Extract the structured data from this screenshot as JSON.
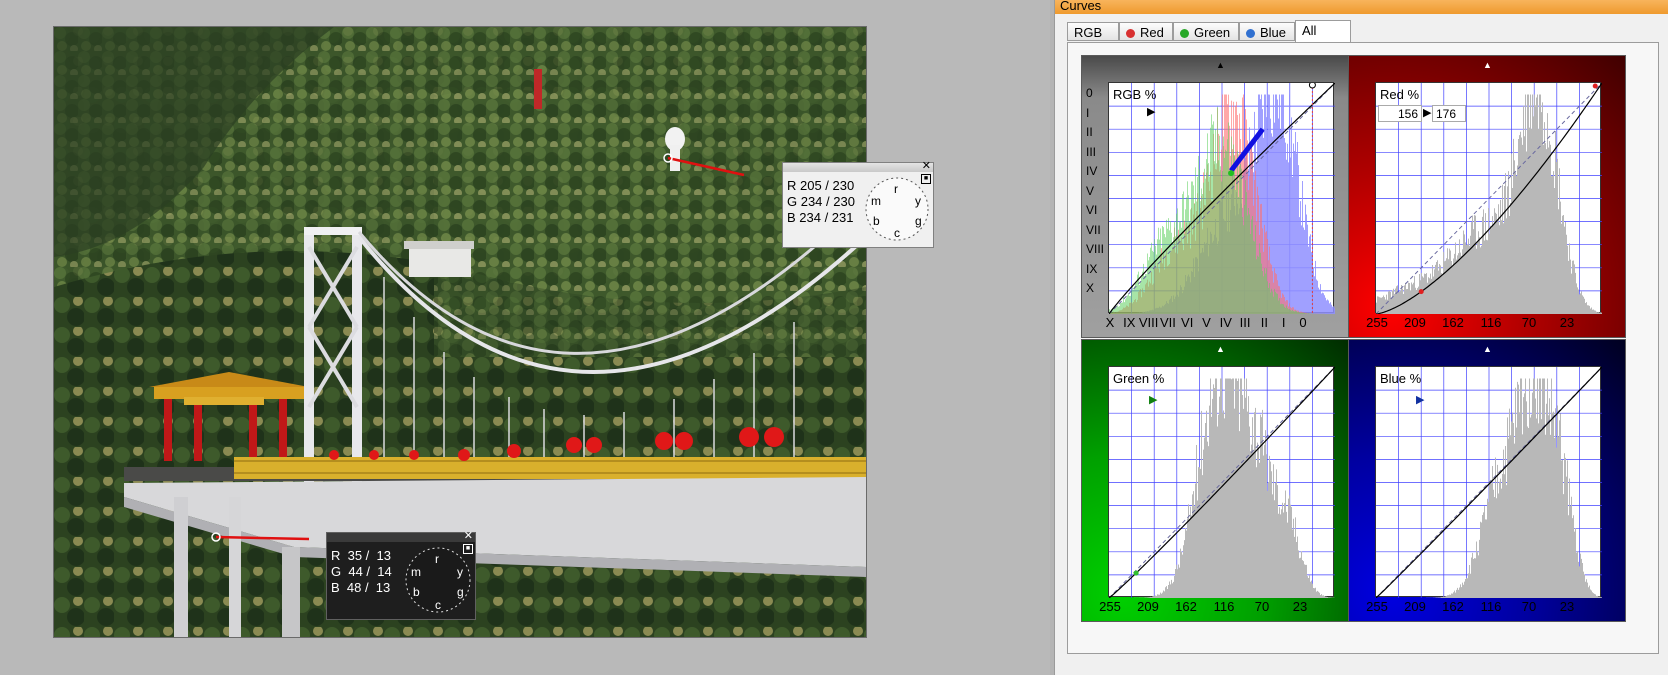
{
  "panel": {
    "title": "Curves",
    "tabs": [
      {
        "label": "RGB",
        "dot": null,
        "active": false
      },
      {
        "label": "Red",
        "dot": "#d83030",
        "active": false
      },
      {
        "label": "Green",
        "dot": "#28a828",
        "active": false
      },
      {
        "label": "Blue",
        "dot": "#3070d0",
        "active": false
      },
      {
        "label": "All",
        "dot": null,
        "active": true
      }
    ]
  },
  "probes": [
    {
      "style": "light",
      "close": "✕",
      "rows": [
        "R 205 / 230",
        "G 234 / 230",
        "B 234 / 231"
      ],
      "wheel": [
        "r",
        "y",
        "g",
        "c",
        "b",
        "m"
      ]
    },
    {
      "style": "dark",
      "close": "✕",
      "rows": [
        "R  35 /  13",
        "G  44 /  14",
        "B  48 /  13"
      ],
      "wheel": [
        "r",
        "y",
        "g",
        "c",
        "b",
        "m"
      ]
    }
  ],
  "graphs": {
    "rgb": {
      "label": "RGB %",
      "yticks": [
        "0",
        "I",
        "II",
        "III",
        "IV",
        "V",
        "VI",
        "VII",
        "VIII",
        "IX",
        "X"
      ],
      "xticks": [
        "X",
        "IX",
        "VIII",
        "VII",
        "VI",
        "V",
        "IV",
        "III",
        "II",
        "I",
        "0"
      ]
    },
    "red": {
      "label": "Red %",
      "input_value": "156",
      "output_value": "176",
      "xticks": [
        "255",
        "209",
        "162",
        "116",
        "70",
        "23"
      ]
    },
    "green": {
      "label": "Green %",
      "xticks": [
        "255",
        "209",
        "162",
        "116",
        "70",
        "23"
      ]
    },
    "blue": {
      "label": "Blue %",
      "xticks": [
        "255",
        "209",
        "162",
        "116",
        "70",
        "23"
      ]
    }
  },
  "colors": {
    "red_bg": "#c00000",
    "green_bg": "#00a000",
    "blue_bg": "#0000a0",
    "grid": "#4040ff",
    "histogram": "#b8b8b8"
  }
}
